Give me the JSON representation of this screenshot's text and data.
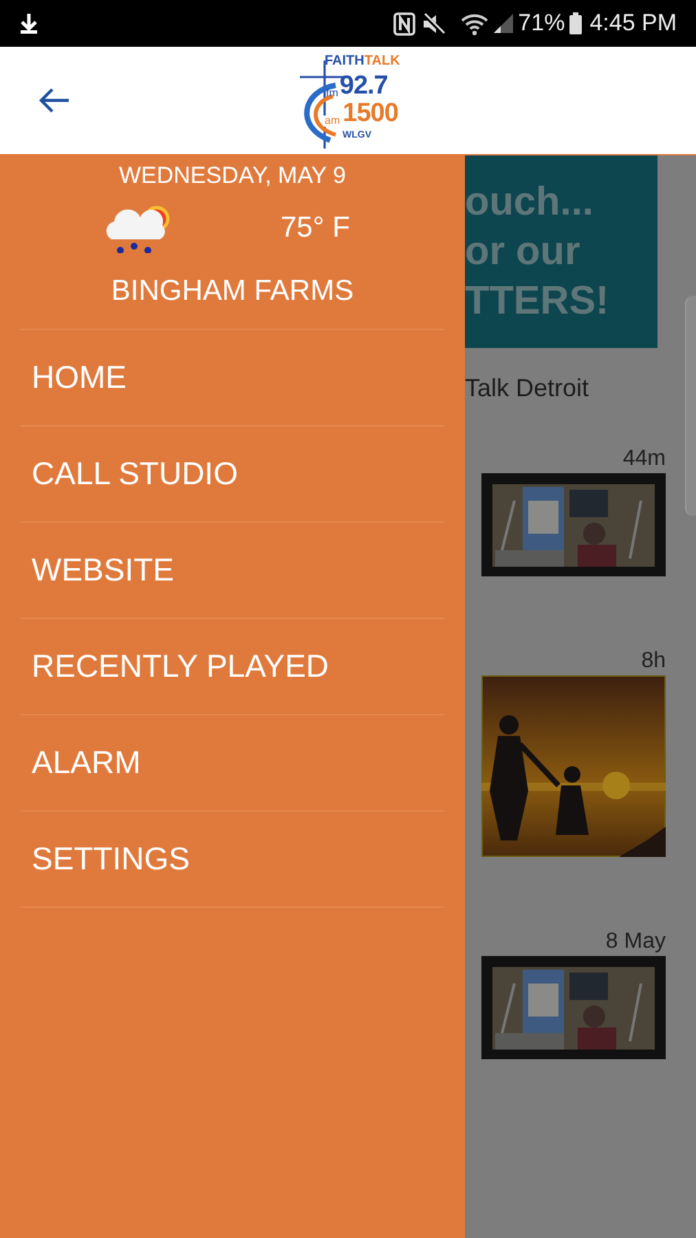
{
  "status_bar": {
    "battery": "71%",
    "time": "4:45 PM"
  },
  "header": {
    "logo": {
      "brand_1": "FAITH",
      "brand_2": "TALK",
      "fm_band": "fm",
      "fm_freq": "92.7",
      "am_band": "am",
      "am_freq": "1500",
      "call_sign": "WLGV"
    }
  },
  "drawer": {
    "date": "WEDNESDAY, MAY 9",
    "temperature": "75° F",
    "location": "BINGHAM FARMS",
    "items": [
      {
        "label": "HOME"
      },
      {
        "label": "CALL STUDIO"
      },
      {
        "label": "WEBSITE"
      },
      {
        "label": "RECENTLY PLAYED"
      },
      {
        "label": "ALARM"
      },
      {
        "label": "SETTINGS"
      }
    ]
  },
  "background": {
    "banner_lines": [
      "ouch...",
      "or our",
      "TTERS!"
    ],
    "feed_title": "Talk Detroit",
    "posts": [
      {
        "time": "44m",
        "kind": "studio"
      },
      {
        "time": "8h",
        "kind": "sunset"
      },
      {
        "time": "8 May",
        "kind": "studio"
      }
    ]
  }
}
